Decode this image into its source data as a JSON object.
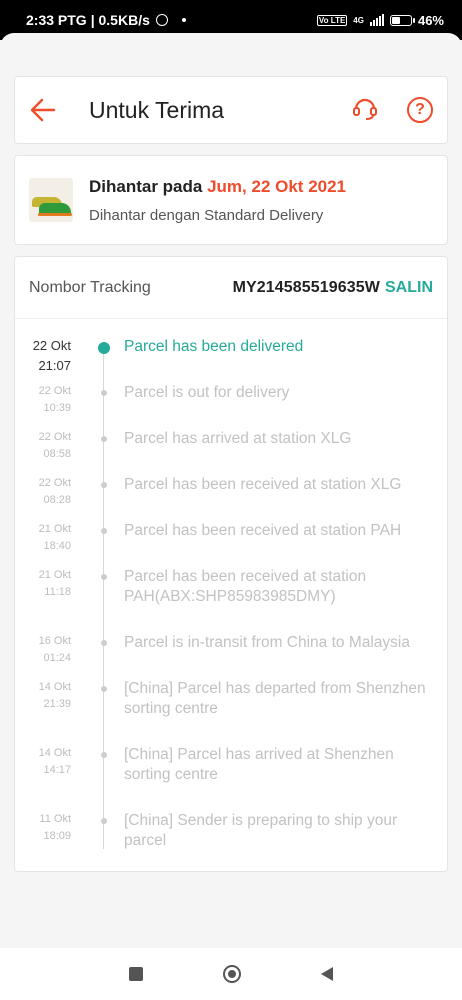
{
  "status_bar": {
    "time": "2:33 PTG",
    "net_speed": "| 0.5KB/s",
    "network_type": "4G",
    "volte": "Vo LTE",
    "battery": "46%",
    "battery_level": 0.46
  },
  "header": {
    "title": "Untuk Terima",
    "back_icon": "arrow-left-icon",
    "support_icon": "headset-icon",
    "help_icon": "question-icon",
    "help_glyph": "?",
    "accent_color": "#ee4d2d"
  },
  "delivery": {
    "label": "Dihantar pada",
    "date": "Jum, 22 Okt 2021",
    "method": "Dihantar dengan Standard Delivery"
  },
  "tracking": {
    "label": "Nombor Tracking",
    "number": "MY214585519635W",
    "copy_label": "SALIN",
    "active_color": "#26aa99",
    "events": [
      {
        "date": "22 Okt",
        "time": "21:07",
        "text": "Parcel has been delivered"
      },
      {
        "date": "22 Okt",
        "time": "10:39",
        "text": "Parcel is out for delivery"
      },
      {
        "date": "22 Okt",
        "time": "08:58",
        "text": "Parcel has arrived at station XLG"
      },
      {
        "date": "22 Okt",
        "time": "08:28",
        "text": "Parcel has been received at station XLG"
      },
      {
        "date": "21 Okt",
        "time": "18:40",
        "text": "Parcel has been received at station PAH"
      },
      {
        "date": "21 Okt",
        "time": "11:18",
        "text": "Parcel has been received at station PAH(ABX:SHP85983985DMY)"
      },
      {
        "date": "16 Okt",
        "time": "01:24",
        "text": "Parcel is in-transit from China to Malaysia"
      },
      {
        "date": "14 Okt",
        "time": "21:39",
        "text": "[China] Parcel has departed from Shenzhen sorting centre"
      },
      {
        "date": "14 Okt",
        "time": "14:17",
        "text": "[China] Parcel has arrived at Shenzhen sorting centre"
      },
      {
        "date": "11 Okt",
        "time": "18:09",
        "text": "[China] Sender is preparing to ship your parcel"
      }
    ]
  },
  "navbar": {
    "recents_icon": "square-icon",
    "home_icon": "circle-icon",
    "back_icon": "triangle-back-icon"
  }
}
